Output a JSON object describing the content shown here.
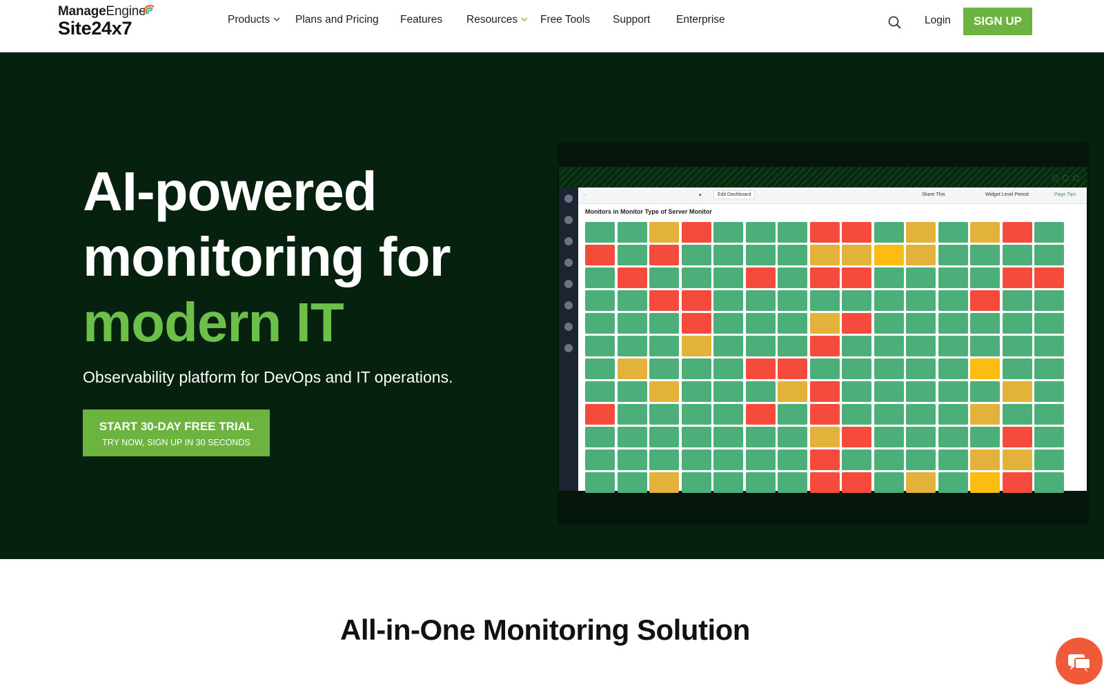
{
  "header": {
    "logo_top_bold": "Manage",
    "logo_top_regular": "Engine",
    "logo_bottom": "Site24x7",
    "nav": [
      {
        "label": "Products",
        "has_dropdown": true
      },
      {
        "label": "Plans and Pricing",
        "has_dropdown": false
      },
      {
        "label": "Features",
        "has_dropdown": false
      },
      {
        "label": "Resources",
        "has_dropdown": true
      },
      {
        "label": "Free Tools",
        "has_dropdown": false
      },
      {
        "label": "Support",
        "has_dropdown": false
      },
      {
        "label": "Enterprise",
        "has_dropdown": false
      }
    ],
    "search_icon": "search-icon",
    "login_label": "Login",
    "signup_label": "SIGN UP"
  },
  "hero": {
    "title_line1": "AI-powered",
    "title_line2": "monitoring for",
    "title_line3": "modern IT",
    "subtitle": "Observability platform for DevOps and IT operations.",
    "cta_main": "START 30-DAY FREE TRIAL",
    "cta_sub": "TRY NOW, SIGN UP IN 30 SECONDS"
  },
  "dashboard": {
    "edit_label": "Edit Dashboard",
    "share_label": "Share This",
    "period_label": "Widget Level Period",
    "tips_label": "Page Tips",
    "widget_title": "Monitors in Monitor Type of Server Monitor",
    "status_colors": {
      "G": "#4caf7a",
      "R": "#f44b3c",
      "Y": "#e3b23a",
      "O": "#fcbc12"
    },
    "rows": [
      "GGYRGGGRRGYGYRG",
      "RGRGGGGYYOYGGGG",
      "GRGGGRGRRGGGGRR",
      "GGRRGGGGGGGGRGG",
      "GGGRGGGYRGGGGGG",
      "GGGYGGGRGGGGGGG",
      "GYGGGRRGGGGGOGG",
      "GGYGGGYRGGGGGYG",
      "RGGGGRGRGGGGYGG",
      "GGGGGGGYRGGGGRG",
      "GGGGGGGRGGGGYYG",
      "GGYGGGGRRGYGORG"
    ]
  },
  "section": {
    "title": "All-in-One Monitoring Solution"
  },
  "chat_icon": "chat-icon"
}
